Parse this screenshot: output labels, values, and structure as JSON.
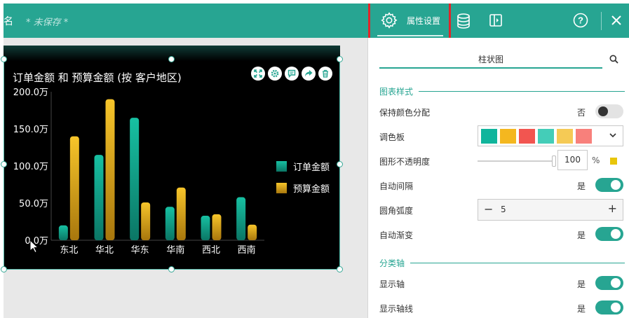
{
  "header": {
    "doc_name": "名",
    "save_status": "* 未保存 *",
    "properties_tab": "属性设置"
  },
  "chart_toolbar_icons": [
    "expand-icon",
    "gear-icon",
    "comment-icon",
    "share-icon",
    "trash-icon"
  ],
  "chart_data": {
    "type": "bar",
    "title": "订单金额 和 预算金额 (按 客户地区)",
    "categories": [
      "东北",
      "华北",
      "华东",
      "华南",
      "西北",
      "西南"
    ],
    "series": [
      {
        "name": "订单金额",
        "values": [
          200000,
          1150000,
          1650000,
          450000,
          330000,
          580000
        ],
        "color": "#16a88e"
      },
      {
        "name": "预算金额",
        "values": [
          1400000,
          1900000,
          510000,
          710000,
          350000,
          210000
        ],
        "color": "#e8b21b"
      }
    ],
    "y_ticks": [
      "0.0万",
      "50.0万",
      "100.0万",
      "150.0万",
      "200.0万"
    ],
    "ylim": [
      0,
      2000000
    ],
    "legend_position": "right",
    "background": "#000000"
  },
  "panel": {
    "chart_type_tab": "柱状图",
    "section_chart_style": "图表样式",
    "keep_color_label": "保持颜色分配",
    "keep_color_state": "否",
    "palette_label": "调色板",
    "palette_colors": [
      "#10b59c",
      "#f4b71f",
      "#f25550",
      "#44cdb8",
      "#f5ca55",
      "#f8807b"
    ],
    "opacity_label": "图形不透明度",
    "opacity_value": "100",
    "opacity_unit": "%",
    "opacity_color": "#e8c60a",
    "auto_gap_label": "自动间隔",
    "auto_gap_state": "是",
    "corner_radius_label": "圆角弧度",
    "corner_radius_value": "5",
    "auto_gradient_label": "自动渐变",
    "auto_gradient_state": "是",
    "section_category_axis": "分类轴",
    "show_axis_label": "显示轴",
    "show_axis_state": "是",
    "show_axis_line_label": "显示轴线",
    "show_axis_line_state": "是"
  }
}
